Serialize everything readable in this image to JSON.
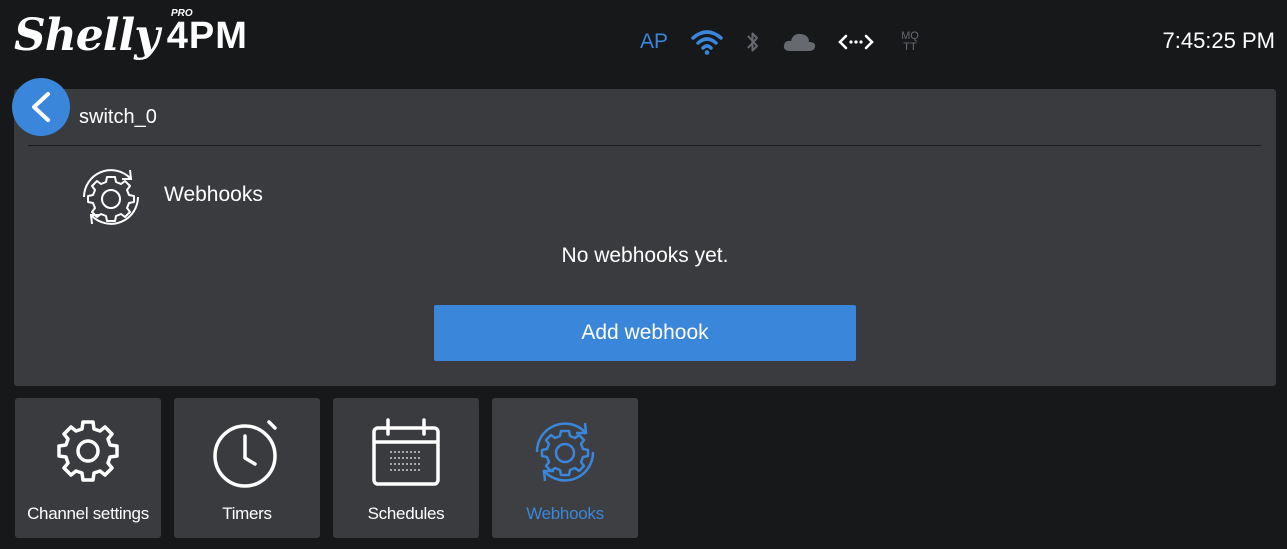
{
  "header": {
    "logo_text": "Shelly",
    "logo_badge": "PRO",
    "logo_model": "4PM",
    "status": {
      "ap_label": "AP",
      "mqtt_line1": "MQ",
      "mqtt_line2": "TT",
      "icons": [
        "wifi-icon",
        "bluetooth-icon",
        "cloud-icon",
        "connection-arrows-icon"
      ]
    },
    "clock": "7:45:25 PM"
  },
  "panel": {
    "channel_name": "switch_0",
    "section_title": "Webhooks",
    "empty_message": "No webhooks yet.",
    "add_button_label": "Add webhook"
  },
  "tabs": [
    {
      "label": "Channel settings",
      "icon": "gear-icon",
      "active": false
    },
    {
      "label": "Timers",
      "icon": "stopwatch-icon",
      "active": false
    },
    {
      "label": "Schedules",
      "icon": "calendar-icon",
      "active": false
    },
    {
      "label": "Webhooks",
      "icon": "webhooks-gear-icon",
      "active": true
    }
  ],
  "colors": {
    "accent": "#3a86db",
    "background": "#17181a",
    "panel": "#3a3b3e",
    "inactive_status": "#666a70"
  }
}
